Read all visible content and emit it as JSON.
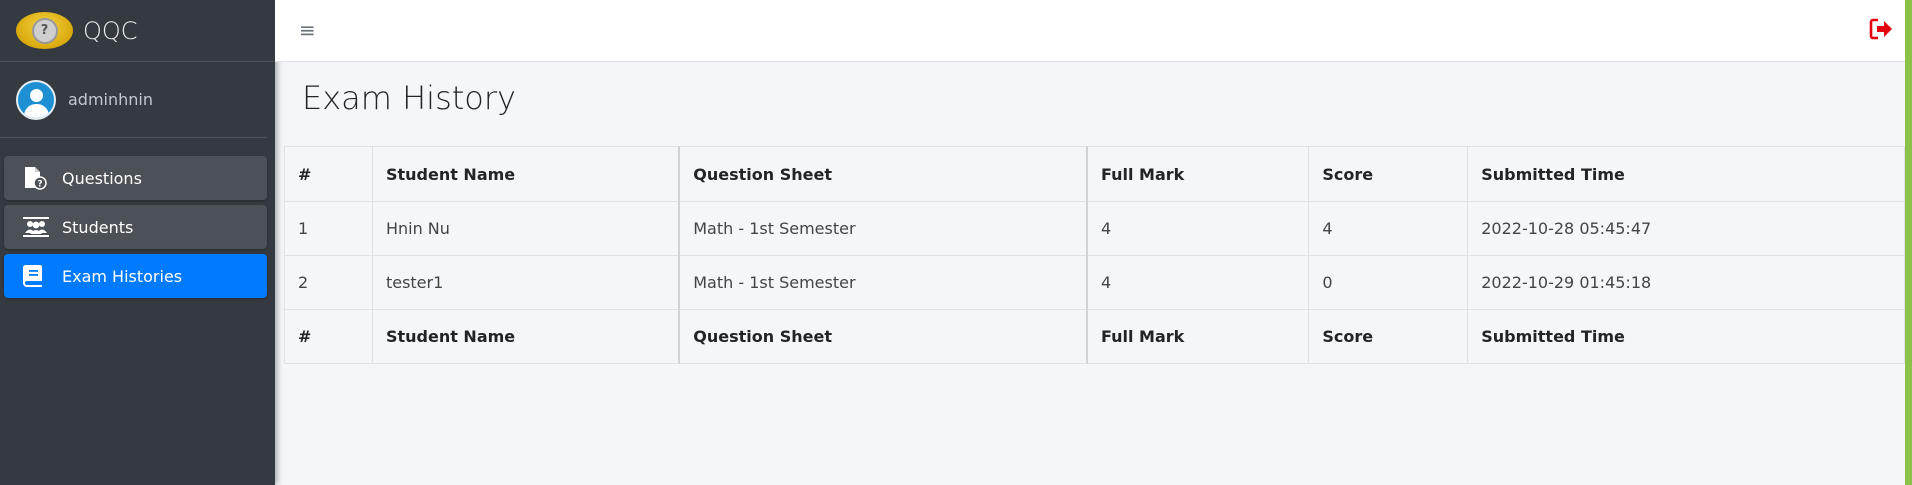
{
  "brand": {
    "name": "QQC",
    "logo_icon": "brain-question-logo"
  },
  "user": {
    "name": "adminhnin"
  },
  "sidebar": {
    "items": [
      {
        "label": "Questions",
        "icon": "question-file-icon",
        "active": false
      },
      {
        "label": "Students",
        "icon": "students-icon",
        "active": false
      },
      {
        "label": "Exam Histories",
        "icon": "book-icon",
        "active": true
      }
    ]
  },
  "topbar": {
    "menu_icon": "≡",
    "logout_icon": "logout-icon"
  },
  "page": {
    "title": "Exam History"
  },
  "table": {
    "headers": [
      "#",
      "Student Name",
      "Question Sheet",
      "Full Mark",
      "Score",
      "Submitted Time"
    ],
    "rows": [
      [
        "1",
        "Hnin Nu",
        "Math - 1st Semester",
        "4",
        "4",
        "2022-10-28 05:45:47"
      ],
      [
        "2",
        "tester1",
        "Math - 1st Semester",
        "4",
        "0",
        "2022-10-29 01:45:18"
      ]
    ],
    "footers": [
      "#",
      "Student Name",
      "Question Sheet",
      "Full Mark",
      "Score",
      "Submitted Time"
    ]
  },
  "colors": {
    "sidebar_bg": "#343a40",
    "active": "#007bff",
    "logout": "#dc3545",
    "content_bg": "#f4f6f9"
  }
}
